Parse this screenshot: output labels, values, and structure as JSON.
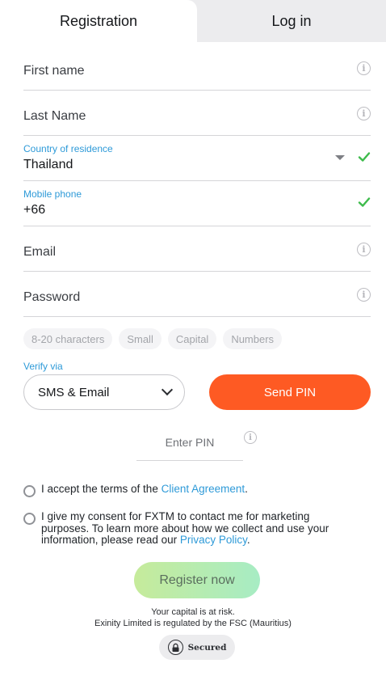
{
  "tabs": [
    {
      "label": "Registration",
      "active": true
    },
    {
      "label": "Log in",
      "active": false
    }
  ],
  "fields": {
    "first_name": {
      "placeholder": "First name"
    },
    "last_name": {
      "placeholder": "Last Name"
    },
    "country": {
      "label": "Country of residence",
      "value": "Thailand"
    },
    "mobile": {
      "label": "Mobile phone",
      "value": "+66"
    },
    "email": {
      "placeholder": "Email"
    },
    "password": {
      "placeholder": "Password"
    }
  },
  "password_rules": [
    "8-20 characters",
    "Small",
    "Capital",
    "Numbers"
  ],
  "verify": {
    "label": "Verify via",
    "selected": "SMS & Email",
    "send_button": "Send PIN",
    "pin_placeholder": "Enter PIN"
  },
  "consents": {
    "terms_prefix": "I accept the terms of the ",
    "terms_link": "Client Agreement",
    "terms_suffix": ".",
    "marketing_prefix": "I give my consent for FXTM to contact me for marketing purposes. To learn more about how we collect and use your information, please read our ",
    "marketing_link": "Privacy Policy",
    "marketing_suffix": "."
  },
  "register_button": "Register now",
  "footer": {
    "risk": "Your capital is at risk.",
    "regulation": "Exinity Limited is regulated by the FSC (Mauritius)",
    "secured": "Secured"
  },
  "colors": {
    "accent_blue": "#2e9ad8",
    "send_orange": "#fe5a23",
    "valid_green": "#3dbb4b",
    "register_gradient": [
      "#c6eb9b",
      "#a7ecc4"
    ]
  },
  "icons": {
    "info": "info-icon",
    "valid": "check-icon",
    "dropdown": "caret-down-icon",
    "select": "chevron-down-icon",
    "secured": "lock-icon"
  }
}
